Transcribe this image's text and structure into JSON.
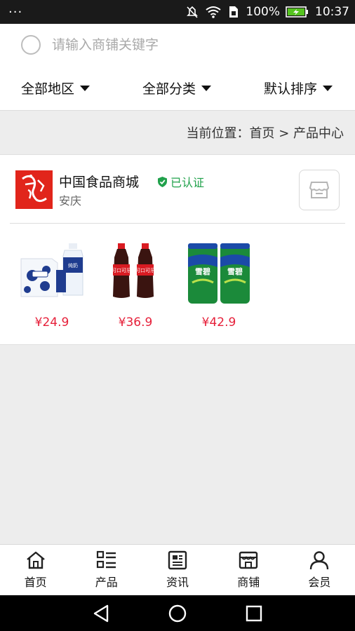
{
  "status_bar": {
    "battery": "100%",
    "time": "10:37"
  },
  "search": {
    "placeholder": "请输入商铺关键字"
  },
  "filters": [
    {
      "label": "全部地区"
    },
    {
      "label": "全部分类"
    },
    {
      "label": "默认排序"
    }
  ],
  "breadcrumb": {
    "text": "当前位置：首页 > 产品中心"
  },
  "store": {
    "name": "中国食品商城",
    "verified_label": "已认证",
    "city": "安庆",
    "products": [
      {
        "price": "¥24.9",
        "image": "milk-box-image"
      },
      {
        "price": "¥36.9",
        "image": "cola-bottles-image"
      },
      {
        "price": "¥42.9",
        "image": "sprite-cans-image"
      }
    ]
  },
  "tabs": [
    {
      "label": "首页",
      "icon": "home-icon"
    },
    {
      "label": "产品",
      "icon": "list-icon"
    },
    {
      "label": "资讯",
      "icon": "news-icon"
    },
    {
      "label": "商铺",
      "icon": "shop-icon"
    },
    {
      "label": "会员",
      "icon": "user-icon"
    }
  ],
  "colors": {
    "price": "#e6203a",
    "verified": "#20a14b",
    "logo": "#e1251b"
  }
}
